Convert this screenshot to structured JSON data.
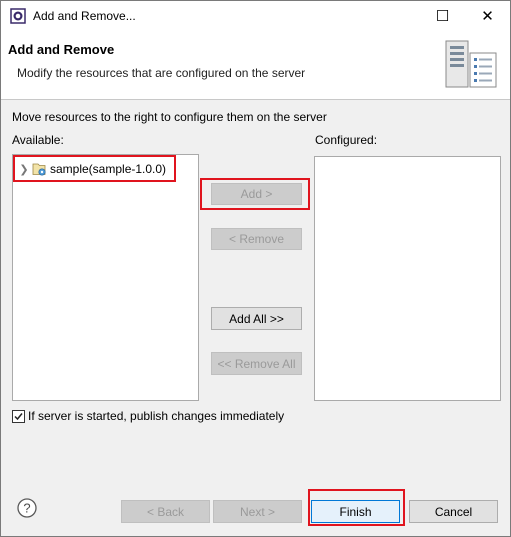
{
  "window": {
    "title": "Add and Remove...",
    "maximize_glyph": "☐",
    "close_glyph": "✕"
  },
  "banner": {
    "title": "Add and Remove",
    "description": "Modify the resources that are configured on the server",
    "icon": "server-icon"
  },
  "main": {
    "instruction": "Move resources to the right to configure them on the server",
    "available_label": "Available:",
    "configured_label": "Configured:",
    "available_items": [
      {
        "label": "sample(sample-1.0.0)",
        "icon": "project-icon",
        "expanded": false
      }
    ],
    "configured_items": []
  },
  "buttons": {
    "add": "Add >",
    "remove": "< Remove",
    "add_all": "Add All >>",
    "remove_all": "<< Remove All"
  },
  "options": {
    "publish_label": "If server is started, publish changes immediately",
    "publish_checked": true
  },
  "footer": {
    "help_icon": "help-icon",
    "back": "< Back",
    "next": "Next >",
    "finish": "Finish",
    "cancel": "Cancel"
  },
  "colors": {
    "highlight": "#e0141e",
    "focus_border": "#0078d7"
  }
}
